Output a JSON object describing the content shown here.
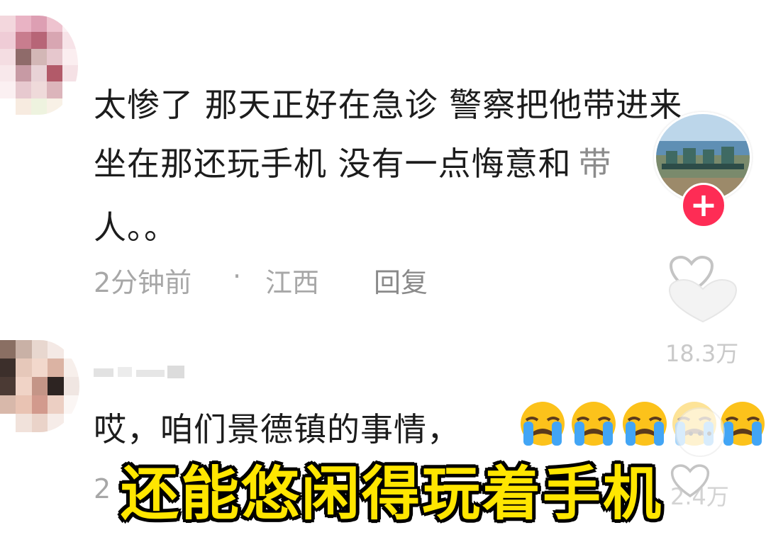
{
  "comments": [
    {
      "lines": [
        "太惨了 那天正好在急诊 警察把他带进来",
        "坐在那还玩手机 没有一点悔意和",
        "人。。"
      ],
      "partial_char_1": "带",
      "time": "2分钟前",
      "separator": "·",
      "location": "江西",
      "reply_label": "回复"
    },
    {
      "text": "哎，咱们景德镇的事情，",
      "emoji_count": 5,
      "time_partial": "2"
    }
  ],
  "side": {
    "follow_plus": "+",
    "likes_1": "18.3万",
    "likes_2": "2.4万"
  },
  "subtitle": "还能悠闲得玩着手机",
  "colors": {
    "accent": "#fe2c55",
    "subtitle": "#ffe600",
    "meta": "#a7a7a7"
  },
  "icons": [
    "heart-icon",
    "plus-icon",
    "loudly-crying-emoji"
  ]
}
